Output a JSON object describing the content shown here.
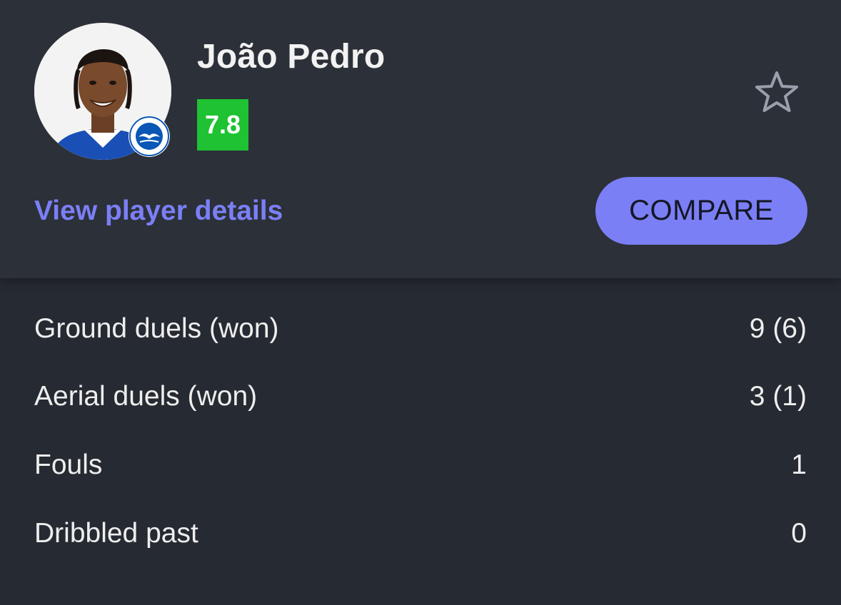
{
  "player": {
    "name": "João Pedro",
    "rating": "7.8",
    "rating_color": "#1ec232",
    "avatar_icon": "player-photo",
    "club_badge_icon": "club-crest-icon"
  },
  "actions": {
    "details_link": "View player details",
    "compare_label": "COMPARE",
    "favorite_icon": "star-outline-icon"
  },
  "colors": {
    "accent": "#7b7ff6",
    "header_bg": "#2c3038",
    "body_bg": "#262a32",
    "text": "#eeeeee"
  },
  "stats": [
    {
      "label": "Ground duels (won)",
      "value": "9 (6)"
    },
    {
      "label": "Aerial duels (won)",
      "value": "3 (1)"
    },
    {
      "label": "Fouls",
      "value": "1"
    },
    {
      "label": "Dribbled past",
      "value": "0"
    }
  ]
}
